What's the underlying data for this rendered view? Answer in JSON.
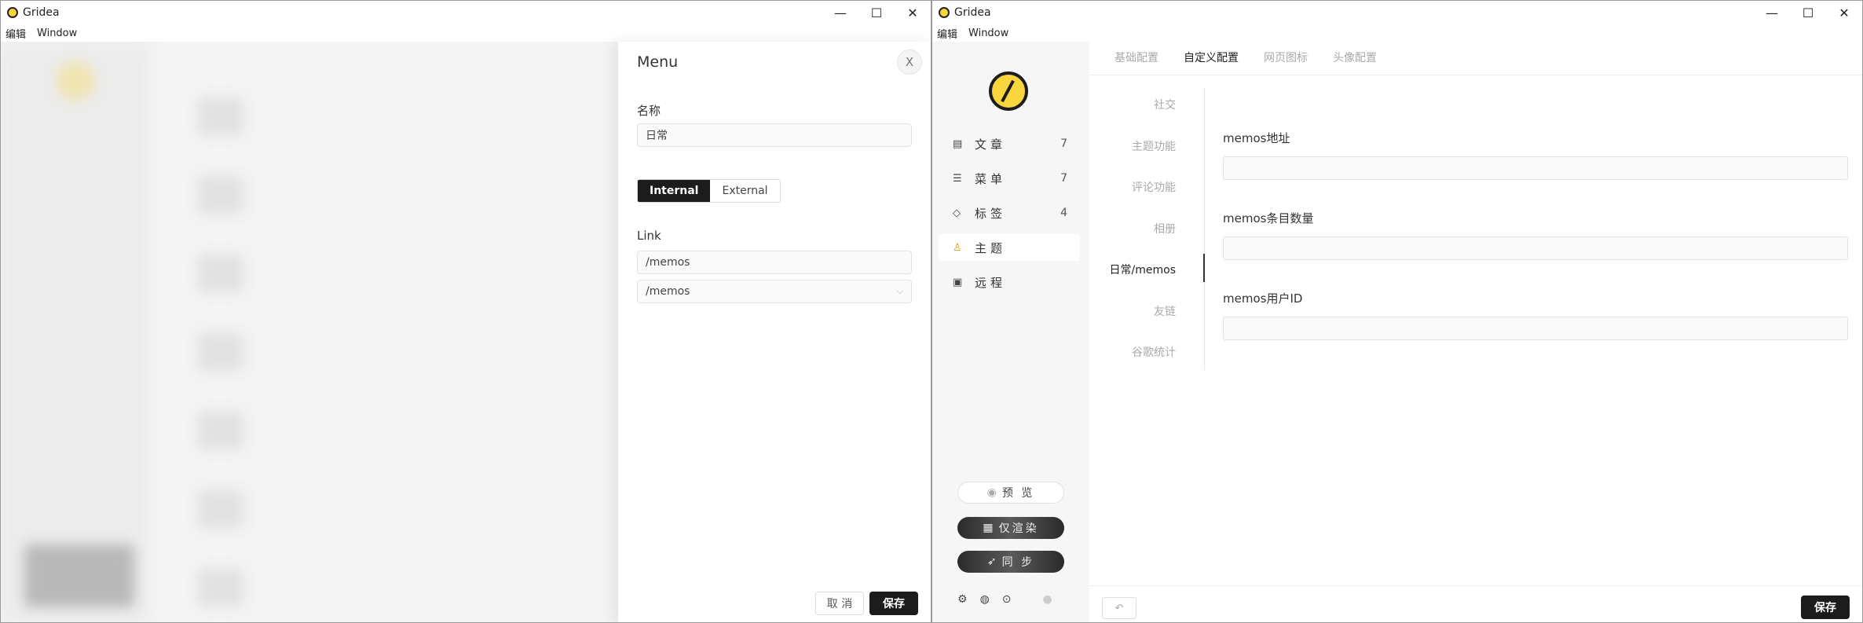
{
  "window_left": {
    "title": "Gridea",
    "menubar": [
      "编辑",
      "Window"
    ],
    "drawer": {
      "title": "Menu",
      "close_label": "X",
      "name_label": "名称",
      "name_value": "日常",
      "segment": [
        "Internal",
        "External"
      ],
      "link_label": "Link",
      "link_value": "/memos",
      "link_select_value": "/memos",
      "cancel_label": "取 消",
      "save_label": "保存"
    }
  },
  "window_right": {
    "title": "Gridea",
    "menubar": [
      "编辑",
      "Window"
    ],
    "sidebar": {
      "items": [
        {
          "icon": "document-icon",
          "label": "文章",
          "count": "7"
        },
        {
          "icon": "menu-icon",
          "label": "菜单",
          "count": "7"
        },
        {
          "icon": "tag-icon",
          "label": "标签",
          "count": "4"
        },
        {
          "icon": "shirt-icon",
          "label": "主题",
          "count": ""
        },
        {
          "icon": "server-icon",
          "label": "远程",
          "count": ""
        }
      ],
      "preview_label": "预 览",
      "render_label": "仅渲染",
      "sync_label": "同 步"
    },
    "tabs": [
      "基础配置",
      "自定义配置",
      "网页图标",
      "头像配置"
    ],
    "active_tab": "自定义配置",
    "subnav": [
      "社交",
      "主题功能",
      "评论功能",
      "相册",
      "日常/memos",
      "友链",
      "谷歌统计"
    ],
    "active_subnav": "日常/memos",
    "fields": [
      {
        "label": "memos地址",
        "value": ""
      },
      {
        "label": "memos条目数量",
        "value": ""
      },
      {
        "label": "memos用户ID",
        "value": ""
      }
    ],
    "undo_label": "↶",
    "save_label": "保存"
  },
  "colors": {
    "accent": "#f8d53c",
    "dark": "#1c1c1c"
  }
}
